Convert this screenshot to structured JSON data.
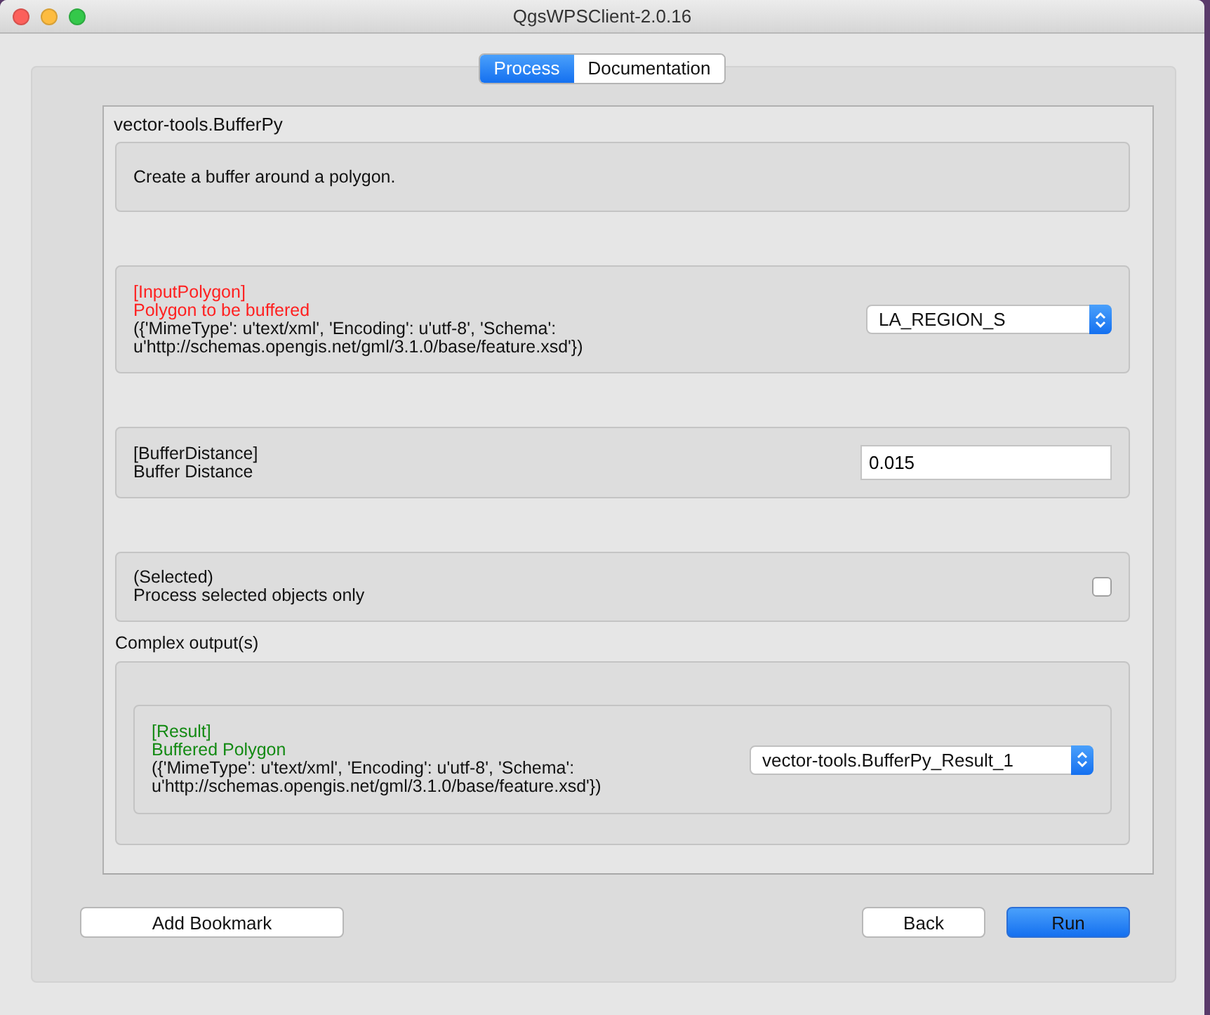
{
  "window": {
    "title": "QgsWPSClient-2.0.16"
  },
  "tabs": [
    {
      "label": "Process",
      "selected": true
    },
    {
      "label": "Documentation",
      "selected": false
    }
  ],
  "process": {
    "title": "vector-tools.BufferPy",
    "abstract": "Create a buffer around a polygon."
  },
  "inputs": [
    {
      "kind": "complex",
      "required": true,
      "identifier": "[InputPolygon]",
      "title": "Polygon to be buffered",
      "formats": "({'MimeType': u'text/xml', 'Encoding': u'utf-8', 'Schema': u'http://schemas.opengis.net/gml/3.1.0/base/feature.xsd'})",
      "value": "LA_REGION_S"
    },
    {
      "kind": "literal",
      "required": false,
      "identifier": "[BufferDistance]",
      "title": "Buffer Distance",
      "value": "0.015"
    },
    {
      "kind": "boolean",
      "required": false,
      "identifier": "(Selected)",
      "title": "Process selected objects only",
      "checked": false
    }
  ],
  "outputs_title": "Complex output(s)",
  "outputs": [
    {
      "identifier": "[Result]",
      "title": "Buffered Polygon",
      "formats": "({'MimeType': u'text/xml', 'Encoding': u'utf-8', 'Schema': u'http://schemas.opengis.net/gml/3.1.0/base/feature.xsd'})",
      "value": "vector-tools.BufferPy_Result_1"
    }
  ],
  "buttons": [
    {
      "label": "Add Bookmark",
      "kind": "plain"
    },
    {
      "label": "Back",
      "kind": "plain"
    },
    {
      "label": "Run",
      "kind": "default"
    }
  ]
}
